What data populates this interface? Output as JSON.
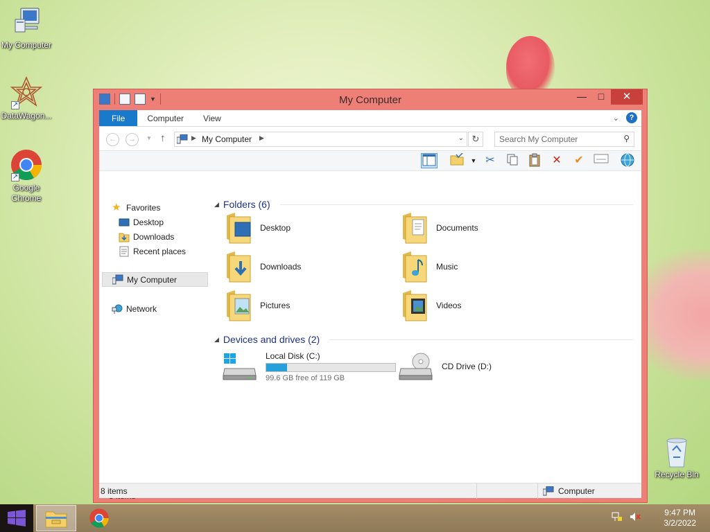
{
  "desktop": {
    "icons": [
      {
        "label": "My Computer"
      },
      {
        "label": "DataWagon..."
      },
      {
        "label": "Google Chrome"
      },
      {
        "label": "Recycle Bin"
      }
    ]
  },
  "window": {
    "title": "My Computer",
    "ribbon_tabs": [
      "File",
      "Computer",
      "View"
    ],
    "help_symbol": "?",
    "address": {
      "path": "My Computer",
      "search_placeholder": "Search My Computer"
    },
    "nav_pane": {
      "favorites": "Favorites",
      "favorite_items": [
        "Desktop",
        "Downloads",
        "Recent places"
      ],
      "my_computer": "My Computer",
      "network": "Network"
    },
    "groups": {
      "folders_title": "Folders (6)",
      "devices_title": "Devices and drives (2)"
    },
    "folders": [
      {
        "label": "Desktop",
        "icon": "desktop-folder-icon"
      },
      {
        "label": "Documents",
        "icon": "documents-folder-icon"
      },
      {
        "label": "Downloads",
        "icon": "downloads-folder-icon"
      },
      {
        "label": "Music",
        "icon": "music-folder-icon"
      },
      {
        "label": "Pictures",
        "icon": "pictures-folder-icon"
      },
      {
        "label": "Videos",
        "icon": "videos-folder-icon"
      }
    ],
    "drives": [
      {
        "label": "Local Disk (C:)",
        "free_text": "99.6 GB free of 119 GB",
        "used_fraction": 0.163
      },
      {
        "label": "CD Drive (D:)"
      }
    ],
    "item_count": "8 items",
    "status": {
      "count": "8 items",
      "zone": "Computer"
    }
  },
  "taskbar": {
    "time": "9:47 PM",
    "date": "3/2/2022"
  },
  "colors": {
    "window_frame": "#ed7f77",
    "close_button": "#c7403a",
    "file_tab": "#1979ca",
    "drive_fill": "#26a0da",
    "group_header": "#1e3287"
  }
}
